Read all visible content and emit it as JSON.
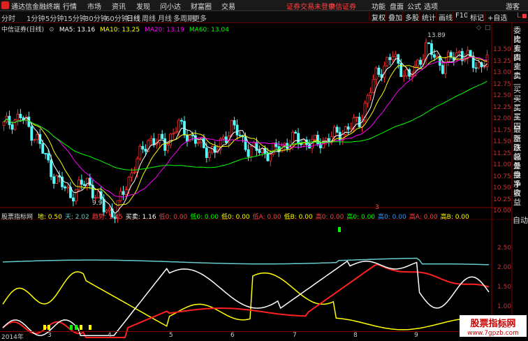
{
  "titlebar": {
    "app_name": "通达信金融终端",
    "menus": [
      "行情",
      "市场",
      "资讯",
      "发现",
      "问小达",
      "财富圈",
      "交易"
    ],
    "notice": "证券交易未登录",
    "broker": "中信证券",
    "right_menus": [
      "功能",
      "盘面",
      "公式",
      "选项"
    ],
    "guest": "游客"
  },
  "toolbar": {
    "periods": [
      "分时",
      "1分钟",
      "5分钟",
      "15分钟",
      "30分钟",
      "60分钟",
      "日线",
      "周线",
      "月线",
      "多周期",
      "更多"
    ],
    "active_period": "日线",
    "right_buttons": [
      "复权",
      "叠加",
      "多股",
      "统计",
      "画线",
      "F10",
      "标记",
      "+自选"
    ]
  },
  "main_chart": {
    "title": "中信证券(日线)",
    "ma": [
      {
        "label": "MA5: 13.16",
        "color": "#ffffff"
      },
      {
        "label": "MA10: 13.25",
        "color": "#ffff00"
      },
      {
        "label": "MA20: 13.19",
        "color": "#ff00ff"
      },
      {
        "label": "MA60: 13.04",
        "color": "#00ff00"
      }
    ],
    "high_label": "13.89",
    "low_label": "9.97",
    "y_ticks": [
      "13.50",
      "13.25",
      "13.00",
      "12.75",
      "12.50",
      "12.25",
      "12.00",
      "11.75",
      "11.50",
      "11.25",
      "11.00",
      "10.75",
      "10.50",
      "10.25",
      "10.00"
    ],
    "marker": "3"
  },
  "right_panel": [
    "委比",
    "卖五",
    "卖四",
    "卖三",
    "卖二",
    "卖一",
    "买一",
    "买二",
    "买三",
    "买四",
    "最新",
    "涨跌",
    "涨幅",
    "总量",
    "外盘",
    "换手",
    "净资",
    "收益"
  ],
  "lower_indicator": {
    "name": "股票指标网",
    "values": [
      {
        "label": "地: 0.50",
        "color": "#ffff00"
      },
      {
        "label": "天: 2.02",
        "color": "#66cccc"
      },
      {
        "label": "趋势: 1.45",
        "color": "#ff4040"
      },
      {
        "label": "买卖: 1.16",
        "color": "#ffffff"
      },
      {
        "label": "低0: 0.00",
        "color": "#ff4040"
      },
      {
        "label": "低0: 0.00",
        "color": "#00ff00"
      },
      {
        "label": "低0: 0.00",
        "color": "#ffff00"
      },
      {
        "label": "低A: 0.00",
        "color": "#ff4040"
      },
      {
        "label": "低B: 0.00",
        "color": "#ffff00"
      },
      {
        "label": "高0: 0.00",
        "color": "#ff4040"
      },
      {
        "label": "高0: 0.00",
        "color": "#00ff00"
      },
      {
        "label": "高0: 0.00",
        "color": "#3399ff"
      },
      {
        "label": "高A: 0.00",
        "color": "#ff4040"
      },
      {
        "label": "高B: 0.00",
        "color": "#ffff00"
      }
    ],
    "y_ticks": [
      "2.50",
      "2.00",
      "1.50",
      "1.00",
      "0.50"
    ],
    "auto_label": "自动"
  },
  "x_axis": {
    "labels": [
      "2014年",
      "3",
      "4",
      "5",
      "6",
      "7",
      "8",
      "9"
    ]
  },
  "watermark": {
    "line1": "股票指标网",
    "line2": "www.7gpzb.com"
  }
}
